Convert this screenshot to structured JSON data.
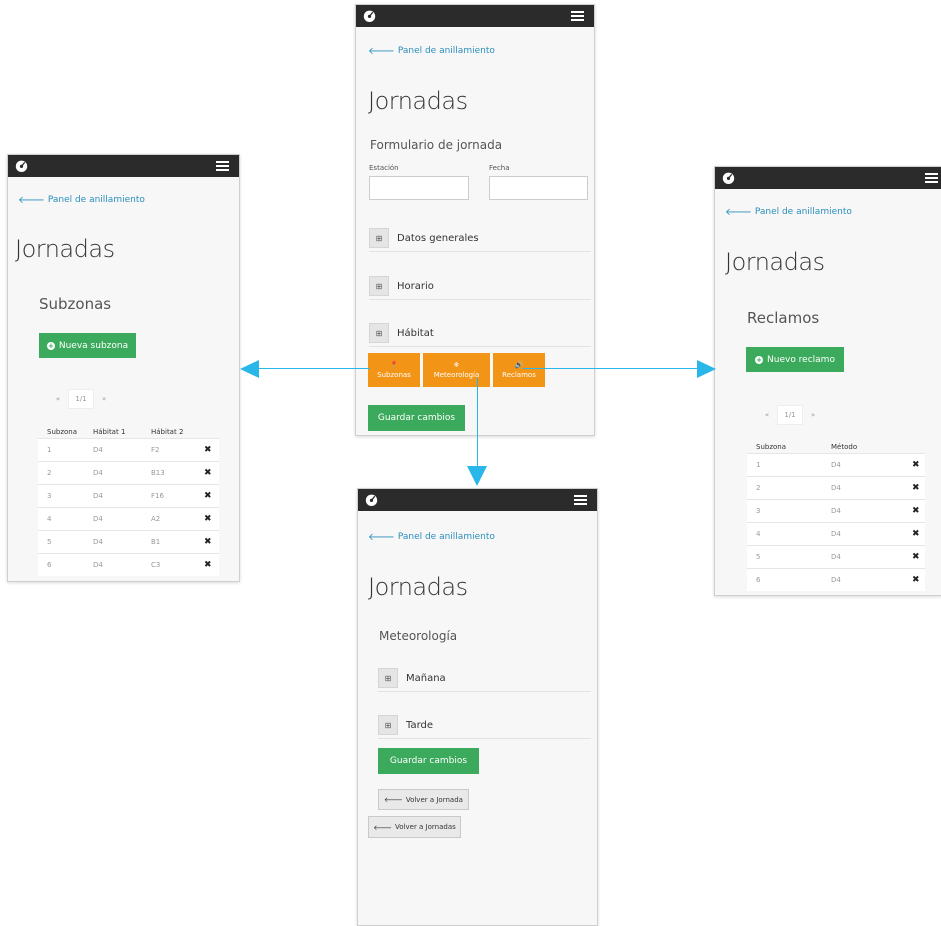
{
  "main_screen": {
    "back_link": "Panel de anillamiento",
    "title": "Jornadas",
    "form_title": "Formulario de jornada",
    "fields": [
      {
        "label": "Estación",
        "value": ""
      },
      {
        "label": "Fecha",
        "value": ""
      }
    ],
    "sections": [
      {
        "label": "Datos generales",
        "icon": "⊞"
      },
      {
        "label": "Horario",
        "icon": "⊞"
      },
      {
        "label": "Hábitat",
        "icon": "⊞"
      }
    ],
    "action_buttons": [
      {
        "label": "Subzonas",
        "icon": "map-pin-icon"
      },
      {
        "label": "Meteorología",
        "icon": "snowflake-icon"
      },
      {
        "label": "Reclamos",
        "icon": "speaker-icon"
      }
    ],
    "save_label": "Guardar cambios"
  },
  "subzonas_screen": {
    "back_link": "Panel de anillamiento",
    "title": "Jornadas",
    "subtitle": "Subzonas",
    "new_button": "Nueva subzona",
    "pager": {
      "prev": "«",
      "current": "1/1",
      "next": "»"
    },
    "columns": [
      "Subzona",
      "Hábitat 1",
      "Hábitat 2",
      ""
    ],
    "rows": [
      [
        "1",
        "D4",
        "F2",
        "✖"
      ],
      [
        "2",
        "D4",
        "B13",
        "✖"
      ],
      [
        "3",
        "D4",
        "F16",
        "✖"
      ],
      [
        "4",
        "D4",
        "A2",
        "✖"
      ],
      [
        "5",
        "D4",
        "B1",
        "✖"
      ],
      [
        "6",
        "D4",
        "C3",
        "✖"
      ]
    ]
  },
  "reclamos_screen": {
    "back_link": "Panel de anillamiento",
    "title": "Jornadas",
    "subtitle": "Reclamos",
    "new_button": "Nuevo reclamo",
    "pager": {
      "prev": "«",
      "current": "1/1",
      "next": "»"
    },
    "columns": [
      "Subzona",
      "Método",
      ""
    ],
    "rows": [
      [
        "1",
        "D4",
        "✖"
      ],
      [
        "2",
        "D4",
        "✖"
      ],
      [
        "3",
        "D4",
        "✖"
      ],
      [
        "4",
        "D4",
        "✖"
      ],
      [
        "5",
        "D4",
        "✖"
      ],
      [
        "6",
        "D4",
        "✖"
      ]
    ]
  },
  "meteo_screen": {
    "back_link": "Panel de anillamiento",
    "title": "Jornadas",
    "subtitle": "Meteorología",
    "sections": [
      {
        "label": "Mañana",
        "icon": "⊞"
      },
      {
        "label": "Tarde",
        "icon": "⊞"
      }
    ],
    "save_label": "Guardar cambios",
    "back_jornada": "Volver a Jornada",
    "back_jornadas": "Volver a Jornadas"
  },
  "colors": {
    "topbar": "#2b2b2b",
    "link": "#2a8fbd",
    "green": "#3caa5c",
    "orange": "#f29416",
    "arrow": "#29b6e8"
  }
}
